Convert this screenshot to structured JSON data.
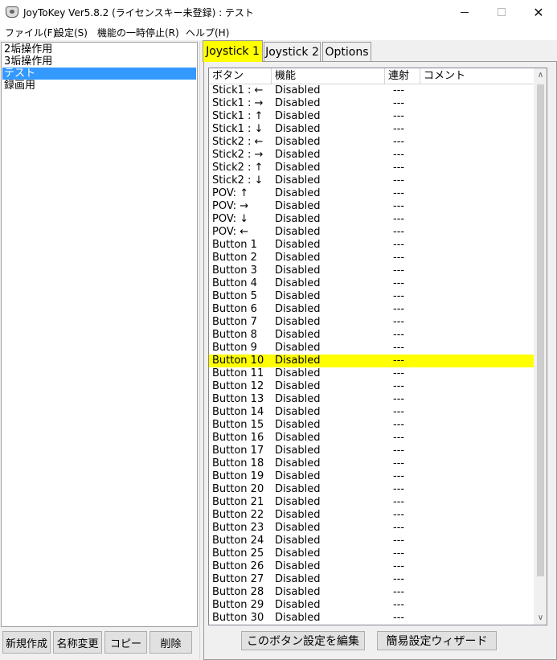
{
  "window": {
    "title": "JoyToKey Ver5.8.2 (ライセンスキー未登録) : テスト",
    "controls": {
      "minimize": "—",
      "maximize": "☐",
      "close": "✕"
    }
  },
  "menu": {
    "items": [
      "ファイル(F)",
      "設定(S)",
      "機能の一時停止(R)",
      "ヘルプ(H)"
    ]
  },
  "profiles": {
    "items": [
      "2垢操作用",
      "3垢操作用",
      "テスト",
      "録画用"
    ],
    "selected_index": 2,
    "selected_color": "#3399ff"
  },
  "left_buttons": {
    "new": "新規作成",
    "rename": "名称変更",
    "copy": "コピー",
    "delete": "削除"
  },
  "tabs": {
    "items": [
      "Joystick 1",
      "Joystick 2",
      "Options"
    ],
    "active_index": 0,
    "active_color": "#ffff00"
  },
  "table": {
    "columns": [
      "ボタン",
      "機能",
      "連射",
      "コメント"
    ],
    "highlight_index": 21,
    "highlight_color": "#ffff00",
    "rows": [
      {
        "button": "Stick1 : ←",
        "function": "Disabled",
        "rapid": "---"
      },
      {
        "button": "Stick1 : →",
        "function": "Disabled",
        "rapid": "---"
      },
      {
        "button": "Stick1 : ↑",
        "function": "Disabled",
        "rapid": "---"
      },
      {
        "button": "Stick1 : ↓",
        "function": "Disabled",
        "rapid": "---"
      },
      {
        "button": "Stick2 : ←",
        "function": "Disabled",
        "rapid": "---"
      },
      {
        "button": "Stick2 : →",
        "function": "Disabled",
        "rapid": "---"
      },
      {
        "button": "Stick2 : ↑",
        "function": "Disabled",
        "rapid": "---"
      },
      {
        "button": "Stick2 : ↓",
        "function": "Disabled",
        "rapid": "---"
      },
      {
        "button": "POV: ↑",
        "function": "Disabled",
        "rapid": "---"
      },
      {
        "button": "POV: →",
        "function": "Disabled",
        "rapid": "---"
      },
      {
        "button": "POV: ↓",
        "function": "Disabled",
        "rapid": "---"
      },
      {
        "button": "POV: ←",
        "function": "Disabled",
        "rapid": "---"
      },
      {
        "button": "Button 1",
        "function": "Disabled",
        "rapid": "---"
      },
      {
        "button": "Button 2",
        "function": "Disabled",
        "rapid": "---"
      },
      {
        "button": "Button 3",
        "function": "Disabled",
        "rapid": "---"
      },
      {
        "button": "Button 4",
        "function": "Disabled",
        "rapid": "---"
      },
      {
        "button": "Button 5",
        "function": "Disabled",
        "rapid": "---"
      },
      {
        "button": "Button 6",
        "function": "Disabled",
        "rapid": "---"
      },
      {
        "button": "Button 7",
        "function": "Disabled",
        "rapid": "---"
      },
      {
        "button": "Button 8",
        "function": "Disabled",
        "rapid": "---"
      },
      {
        "button": "Button 9",
        "function": "Disabled",
        "rapid": "---"
      },
      {
        "button": "Button 10",
        "function": "Disabled",
        "rapid": "---"
      },
      {
        "button": "Button 11",
        "function": "Disabled",
        "rapid": "---"
      },
      {
        "button": "Button 12",
        "function": "Disabled",
        "rapid": "---"
      },
      {
        "button": "Button 13",
        "function": "Disabled",
        "rapid": "---"
      },
      {
        "button": "Button 14",
        "function": "Disabled",
        "rapid": "---"
      },
      {
        "button": "Button 15",
        "function": "Disabled",
        "rapid": "---"
      },
      {
        "button": "Button 16",
        "function": "Disabled",
        "rapid": "---"
      },
      {
        "button": "Button 17",
        "function": "Disabled",
        "rapid": "---"
      },
      {
        "button": "Button 18",
        "function": "Disabled",
        "rapid": "---"
      },
      {
        "button": "Button 19",
        "function": "Disabled",
        "rapid": "---"
      },
      {
        "button": "Button 20",
        "function": "Disabled",
        "rapid": "---"
      },
      {
        "button": "Button 21",
        "function": "Disabled",
        "rapid": "---"
      },
      {
        "button": "Button 22",
        "function": "Disabled",
        "rapid": "---"
      },
      {
        "button": "Button 23",
        "function": "Disabled",
        "rapid": "---"
      },
      {
        "button": "Button 24",
        "function": "Disabled",
        "rapid": "---"
      },
      {
        "button": "Button 25",
        "function": "Disabled",
        "rapid": "---"
      },
      {
        "button": "Button 26",
        "function": "Disabled",
        "rapid": "---"
      },
      {
        "button": "Button 27",
        "function": "Disabled",
        "rapid": "---"
      },
      {
        "button": "Button 28",
        "function": "Disabled",
        "rapid": "---"
      },
      {
        "button": "Button 29",
        "function": "Disabled",
        "rapid": "---"
      },
      {
        "button": "Button 30",
        "function": "Disabled",
        "rapid": "---"
      }
    ]
  },
  "scrollbar": {
    "up_icon": "chevron-up-icon",
    "down_icon": "chevron-down-icon"
  },
  "right_buttons": {
    "edit": "このボタン設定を編集",
    "wizard": "簡易設定ウィザード"
  }
}
